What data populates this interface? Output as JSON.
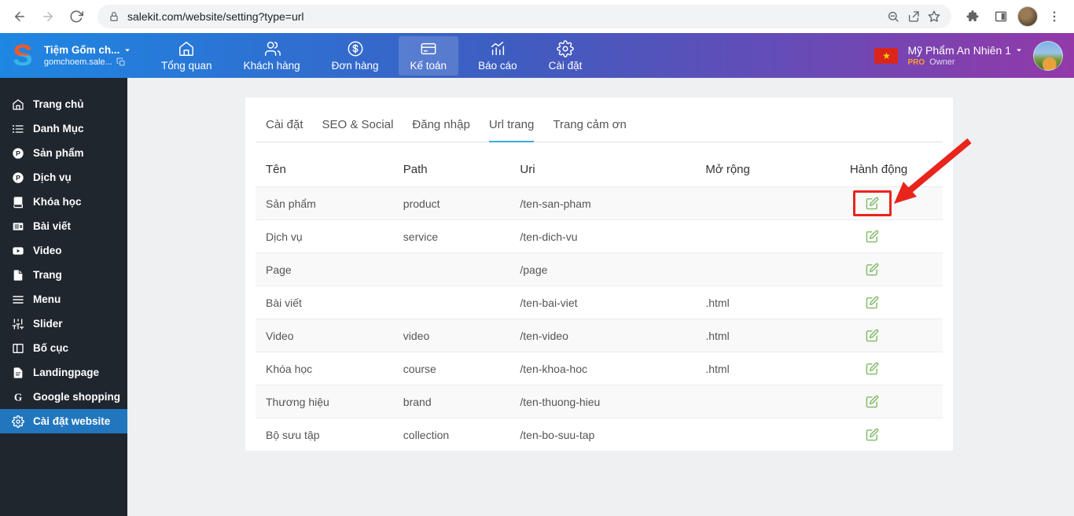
{
  "browser": {
    "url": "salekit.com/website/setting?type=url",
    "icons": {
      "back": "arrow-left",
      "forward": "arrow-right",
      "refresh": "refresh",
      "lock": "lock",
      "zoom": "zoom-out",
      "share": "share",
      "bookmark": "star",
      "extensions": "puzzle",
      "side_panel": "side-panel",
      "menu": "kebab"
    }
  },
  "topbar": {
    "brand": {
      "initial": "S",
      "shop_name": "Tiệm Gốm ch...",
      "shop_domain": "gomchoem.sale...",
      "dropdown_icon": "caret-down",
      "copy_icon": "copy"
    },
    "nav": [
      {
        "id": "tong-quan",
        "label": "Tổng quan",
        "icon": "home",
        "active": false
      },
      {
        "id": "khach-hang",
        "label": "Khách hàng",
        "icon": "users",
        "active": false
      },
      {
        "id": "don-hang",
        "label": "Đơn hàng",
        "icon": "dollar-circle",
        "active": false
      },
      {
        "id": "ke-toan",
        "label": "Kế toán",
        "icon": "credit-card",
        "active": true
      },
      {
        "id": "bao-cao",
        "label": "Báo cáo",
        "icon": "bar-chart",
        "active": false
      },
      {
        "id": "cai-dat",
        "label": "Cài đặt",
        "icon": "gear",
        "active": false
      }
    ],
    "account": {
      "flag_icon": "vietnam-flag",
      "flag_star": "★",
      "name": "Mỹ Phẩm An Nhiên 1",
      "dropdown_icon": "caret-down",
      "plan": "PRO",
      "role": "Owner"
    }
  },
  "sidebar": {
    "items": [
      {
        "id": "trang-chu",
        "label": "Trang chủ",
        "icon": "home",
        "active": false
      },
      {
        "id": "danh-muc",
        "label": "Danh Mục",
        "icon": "list",
        "active": false
      },
      {
        "id": "san-pham",
        "label": "Sản phẩm",
        "icon": "circle-p",
        "active": false
      },
      {
        "id": "dich-vu",
        "label": "Dịch vụ",
        "icon": "circle-p",
        "active": false
      },
      {
        "id": "khoa-hoc",
        "label": "Khóa học",
        "icon": "book",
        "active": false
      },
      {
        "id": "bai-viet",
        "label": "Bài viết",
        "icon": "newspaper",
        "active": false
      },
      {
        "id": "video",
        "label": "Video",
        "icon": "video",
        "active": false
      },
      {
        "id": "trang",
        "label": "Trang",
        "icon": "file",
        "active": false
      },
      {
        "id": "menu",
        "label": "Menu",
        "icon": "menu",
        "active": false
      },
      {
        "id": "slider",
        "label": "Slider",
        "icon": "sliders",
        "active": false
      },
      {
        "id": "bo-cuc",
        "label": "Bố cục",
        "icon": "columns",
        "active": false
      },
      {
        "id": "landingpage",
        "label": "Landingpage",
        "icon": "file-text",
        "active": false
      },
      {
        "id": "google-shopping",
        "label": "Google shopping",
        "icon": "g-letter",
        "active": false
      },
      {
        "id": "cai-dat-website",
        "label": "Cài đặt website",
        "icon": "gear",
        "active": true
      }
    ]
  },
  "main": {
    "tabs": [
      {
        "id": "cai-dat",
        "label": "Cài đặt",
        "active": false
      },
      {
        "id": "seo-social",
        "label": "SEO & Social",
        "active": false
      },
      {
        "id": "dang-nhap",
        "label": "Đăng nhập",
        "active": false
      },
      {
        "id": "url-trang",
        "label": "Url trang",
        "active": true
      },
      {
        "id": "trang-cam-on",
        "label": "Trang cảm ơn",
        "active": false
      }
    ],
    "table": {
      "columns": [
        "Tên",
        "Path",
        "Uri",
        "Mở rộng",
        "Hành động"
      ],
      "action_icon": "edit",
      "rows": [
        {
          "ten": "Sản phẩm",
          "path": "product",
          "uri": "/ten-san-pham",
          "ext": "",
          "highlighted": true
        },
        {
          "ten": "Dịch vụ",
          "path": "service",
          "uri": "/ten-dich-vu",
          "ext": "",
          "highlighted": false
        },
        {
          "ten": "Page",
          "path": "",
          "uri": "/page",
          "ext": "",
          "highlighted": false
        },
        {
          "ten": "Bài viết",
          "path": "",
          "uri": "/ten-bai-viet",
          "ext": ".html",
          "highlighted": false
        },
        {
          "ten": "Video",
          "path": "video",
          "uri": "/ten-video",
          "ext": ".html",
          "highlighted": false
        },
        {
          "ten": "Khóa học",
          "path": "course",
          "uri": "/ten-khoa-hoc",
          "ext": ".html",
          "highlighted": false
        },
        {
          "ten": "Thương hiệu",
          "path": "brand",
          "uri": "/ten-thuong-hieu",
          "ext": "",
          "highlighted": false
        },
        {
          "ten": "Bộ sưu tập",
          "path": "collection",
          "uri": "/ten-bo-suu-tap",
          "ext": "",
          "highlighted": false
        }
      ]
    }
  },
  "annotation": {
    "type": "red-arrow-and-box",
    "target": "edit icon of row Sản phẩm",
    "color": "#e8251d"
  },
  "colors": {
    "topbar_gradient_start": "#1e87e2",
    "topbar_gradient_end": "#9339a9",
    "sidebar_bg": "#20262e",
    "sidebar_active_bg": "#2176bd",
    "tab_underline": "#3aabdc",
    "edit_icon_green": "#7eba65",
    "annotation_red": "#e8251d",
    "pro_badge_orange": "#ff9d2b",
    "flag_red": "#da251d",
    "flag_star_yellow": "#ffd400",
    "omnibox_bg": "#f1f3f4"
  }
}
